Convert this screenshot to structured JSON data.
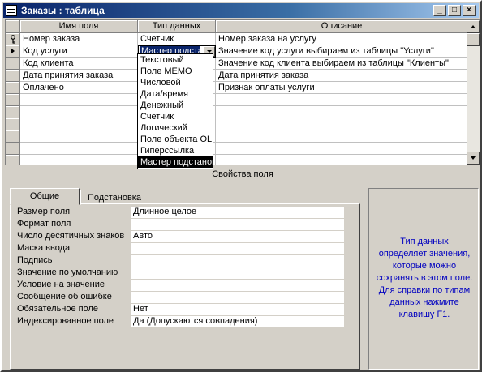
{
  "window": {
    "title": "Заказы : таблица"
  },
  "grid": {
    "columns": [
      "Имя поля",
      "Тип данных",
      "Описание"
    ],
    "rows": [
      {
        "name": "Номер заказа",
        "type": "Счетчик",
        "desc": "Номер заказа на услугу"
      },
      {
        "name": "Код услуги",
        "type": "Мастер подстановок",
        "desc": "Значение код услуги  выбираем из таблицы \"Услуги\""
      },
      {
        "name": "Код клиента",
        "type": "",
        "desc": "Значение код клиента  выбираем из таблицы \"Клиенты\""
      },
      {
        "name": "Дата принятия заказа",
        "type": "",
        "desc": "Дата принятия заказа"
      },
      {
        "name": "Оплачено",
        "type": "",
        "desc": "Признак оплаты услуги"
      }
    ],
    "dropdown_options": [
      "Текстовый",
      "Поле MEMO",
      "Числовой",
      "Дата/время",
      "Денежный",
      "Счетчик",
      "Логический",
      "Поле объекта OLE",
      "Гиперссылка",
      "Мастер подстановок"
    ],
    "dropdown_selected_index": 9
  },
  "props": {
    "title": "Свойства поля",
    "tabs": [
      "Общие",
      "Подстановка"
    ],
    "fields": [
      {
        "label": "Размер поля",
        "value": "Длинное целое"
      },
      {
        "label": "Формат поля",
        "value": ""
      },
      {
        "label": "Число десятичных знаков",
        "value": "Авто"
      },
      {
        "label": "Маска ввода",
        "value": ""
      },
      {
        "label": "Подпись",
        "value": ""
      },
      {
        "label": "Значение по умолчанию",
        "value": ""
      },
      {
        "label": "Условие на значение",
        "value": ""
      },
      {
        "label": "Сообщение об ошибке",
        "value": ""
      },
      {
        "label": "Обязательное поле",
        "value": "Нет"
      },
      {
        "label": "Индексированное поле",
        "value": "Да (Допускаются совпадения)"
      }
    ]
  },
  "help": {
    "text": "Тип данных определяет значения, которые можно сохранять в этом поле.  Для справки по типам данных нажмите клавишу F1."
  },
  "colors": {
    "title_start": "#0a246a",
    "title_end": "#a6caf0",
    "help_text": "#0000c0",
    "chrome": "#d4d0c8"
  }
}
